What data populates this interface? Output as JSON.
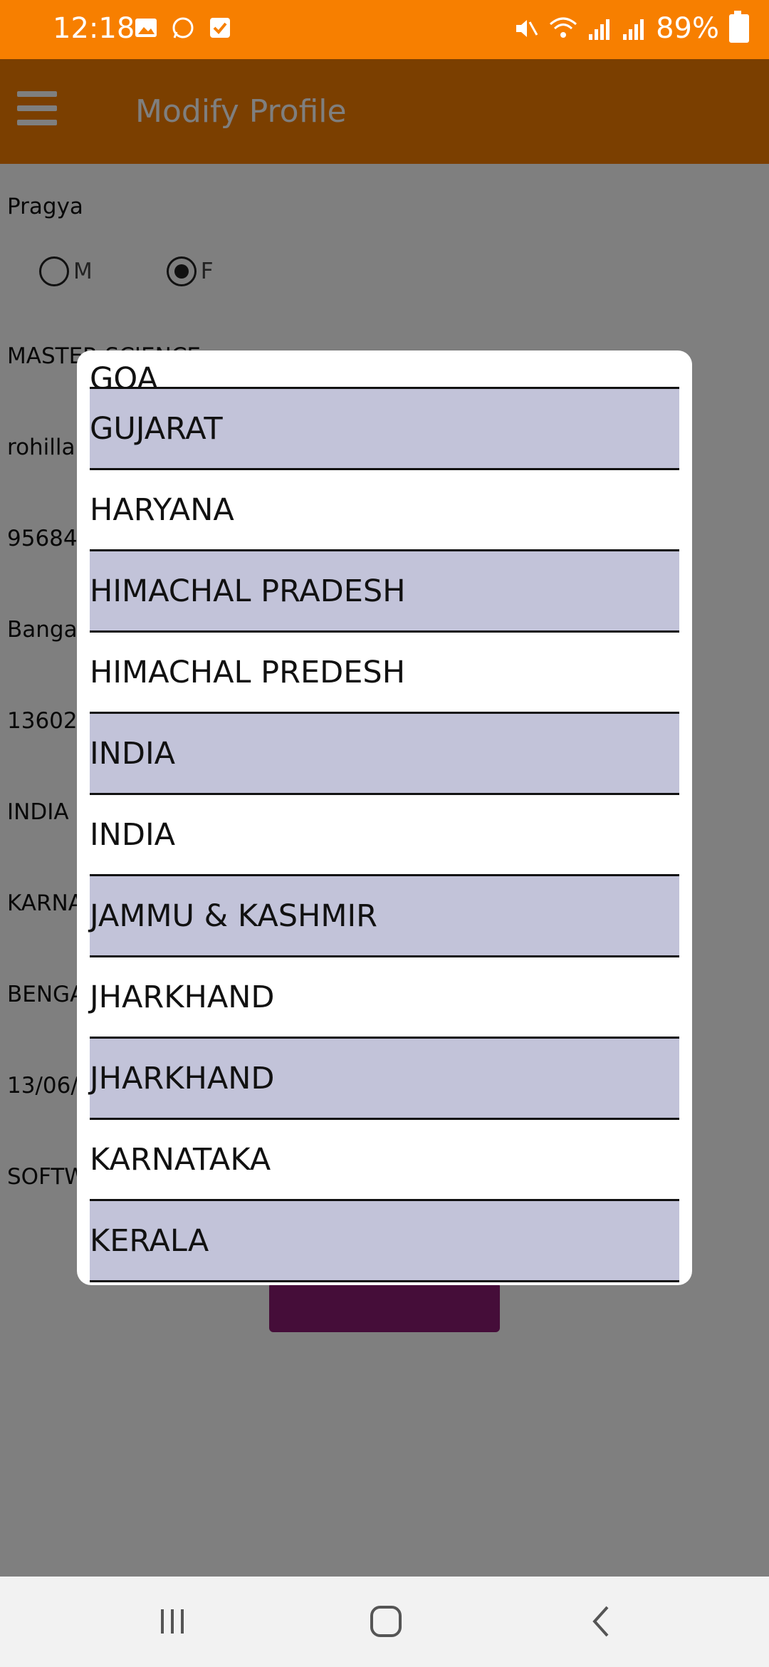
{
  "status": {
    "time": "12:18",
    "battery": "89%"
  },
  "app": {
    "title": "Modify Profile"
  },
  "form": {
    "name": "Pragya",
    "gender_options": [
      "M",
      "F"
    ],
    "gender_selected": "F",
    "qualification": "MASTER SCIENCE",
    "username": "rohilla",
    "phone": "95684",
    "city": "Banga",
    "pincode": "13602",
    "country": "INDIA",
    "state": "KARNA",
    "district": "BENGA",
    "dob": "13/06/",
    "occupation": "SOFTW"
  },
  "dialog": {
    "items": [
      "GOA",
      "GUJARAT",
      "HARYANA",
      "HIMACHAL PRADESH",
      "HIMACHAL PREDESH",
      "INDIA",
      "INDIA",
      "JAMMU & KASHMIR",
      "JHARKHAND",
      "JHARKHAND",
      "KARNATAKA",
      "KERALA"
    ]
  },
  "colors": {
    "accent": "#f77f00",
    "submit": "#8b1a72",
    "row_shade": "#c2c3d9"
  }
}
